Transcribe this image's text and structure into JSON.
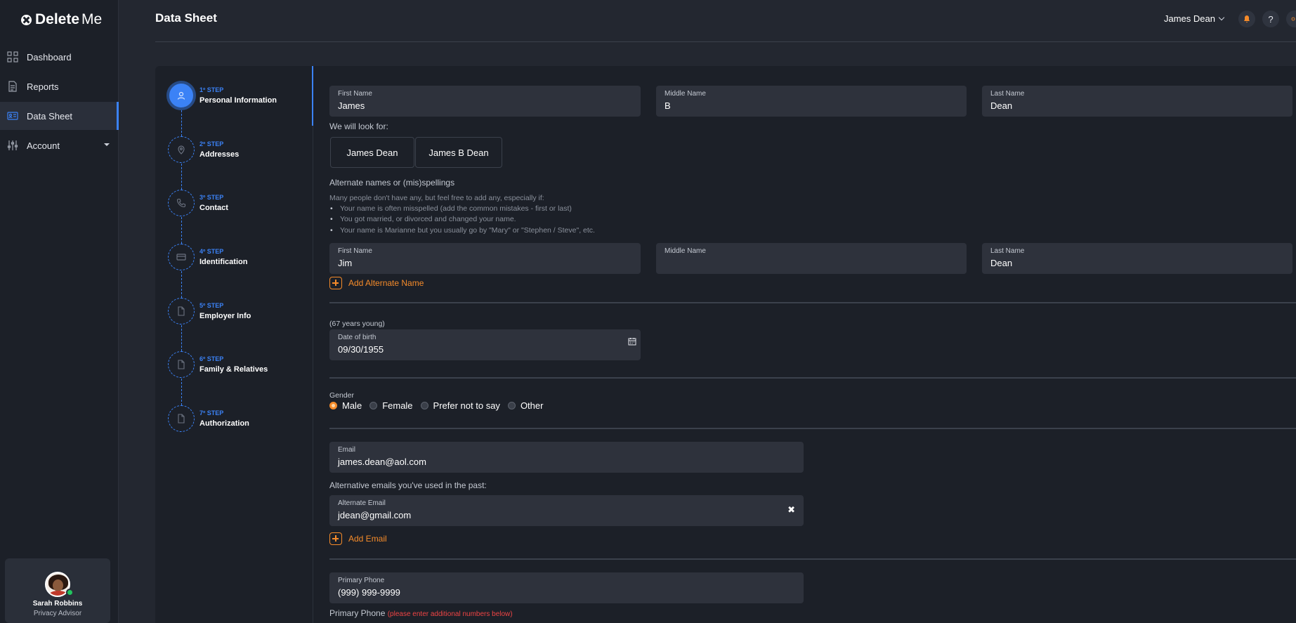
{
  "brand": {
    "name_bold": "Delete",
    "name_light": "Me"
  },
  "sidebar": {
    "items": [
      {
        "label": "Dashboard",
        "icon": "grid-icon"
      },
      {
        "label": "Reports",
        "icon": "document-icon"
      },
      {
        "label": "Data Sheet",
        "icon": "id-card-icon",
        "active": true
      },
      {
        "label": "Account",
        "icon": "sliders-icon",
        "expandable": true
      }
    ],
    "advisor": {
      "name": "Sarah Robbins",
      "role": "Privacy Advisor",
      "status": "online"
    }
  },
  "header": {
    "title": "Data Sheet",
    "user_name": "James Dean",
    "icons": [
      "bell-icon",
      "help-icon",
      "sun-icon"
    ]
  },
  "steps": [
    {
      "num": "1º STEP",
      "label": "Personal Information",
      "icon": "user-icon",
      "active": true
    },
    {
      "num": "2º STEP",
      "label": "Addresses",
      "icon": "map-pin-icon"
    },
    {
      "num": "3º STEP",
      "label": "Contact",
      "icon": "phone-icon"
    },
    {
      "num": "4º STEP",
      "label": "Identification",
      "icon": "id-card-icon"
    },
    {
      "num": "5º STEP",
      "label": "Employer Info",
      "icon": "file-icon"
    },
    {
      "num": "6º STEP",
      "label": "Family & Relatives",
      "icon": "file-icon"
    },
    {
      "num": "7º STEP",
      "label": "Authorization",
      "icon": "file-icon"
    }
  ],
  "form": {
    "name": {
      "first_label": "First Name",
      "first_value": "James",
      "middle_label": "Middle Name",
      "middle_value": "B",
      "last_label": "Last Name",
      "last_value": "Dean"
    },
    "look_for_label": "We will look for:",
    "look_for": [
      "James Dean",
      "James B Dean"
    ],
    "alternate": {
      "title": "Alternate names or (mis)spellings",
      "hint": "Many people don't have any, but feel free to add any, especially if:",
      "bullets": [
        "Your name is often misspelled (add the common mistakes - first or last)",
        "You got married, or divorced and changed your name.",
        "Your name is Marianne but you usually go by \"Mary\" or \"Stephen / Steve\", etc."
      ],
      "first_label": "First Name",
      "first_value": "Jim",
      "middle_label": "Middle Name",
      "middle_value": "",
      "last_label": "Last Name",
      "last_value": "Dean",
      "add_label": "Add Alternate Name"
    },
    "age_note": "(67 years young)",
    "dob_label": "Date of birth",
    "dob_value": "09/30/1955",
    "gender_label": "Gender",
    "gender_options": [
      "Male",
      "Female",
      "Prefer not to say",
      "Other"
    ],
    "gender_selected": "Male",
    "email_label": "Email",
    "email_value": "james.dean@aol.com",
    "alt_emails_title": "Alternative emails you've used in the past:",
    "alt_email_label": "Alternate Email",
    "alt_email_value": "jdean@gmail.com",
    "add_email_label": "Add Email",
    "phone_label": "Primary Phone",
    "phone_value": "(999) 999-9999",
    "phone_note_label": "Primary Phone",
    "phone_note_warning": "(please enter additional numbers below)"
  },
  "colors": {
    "accent_blue": "#3b82f6",
    "accent_orange": "#f58b2a",
    "warning_red": "#ef4444"
  }
}
